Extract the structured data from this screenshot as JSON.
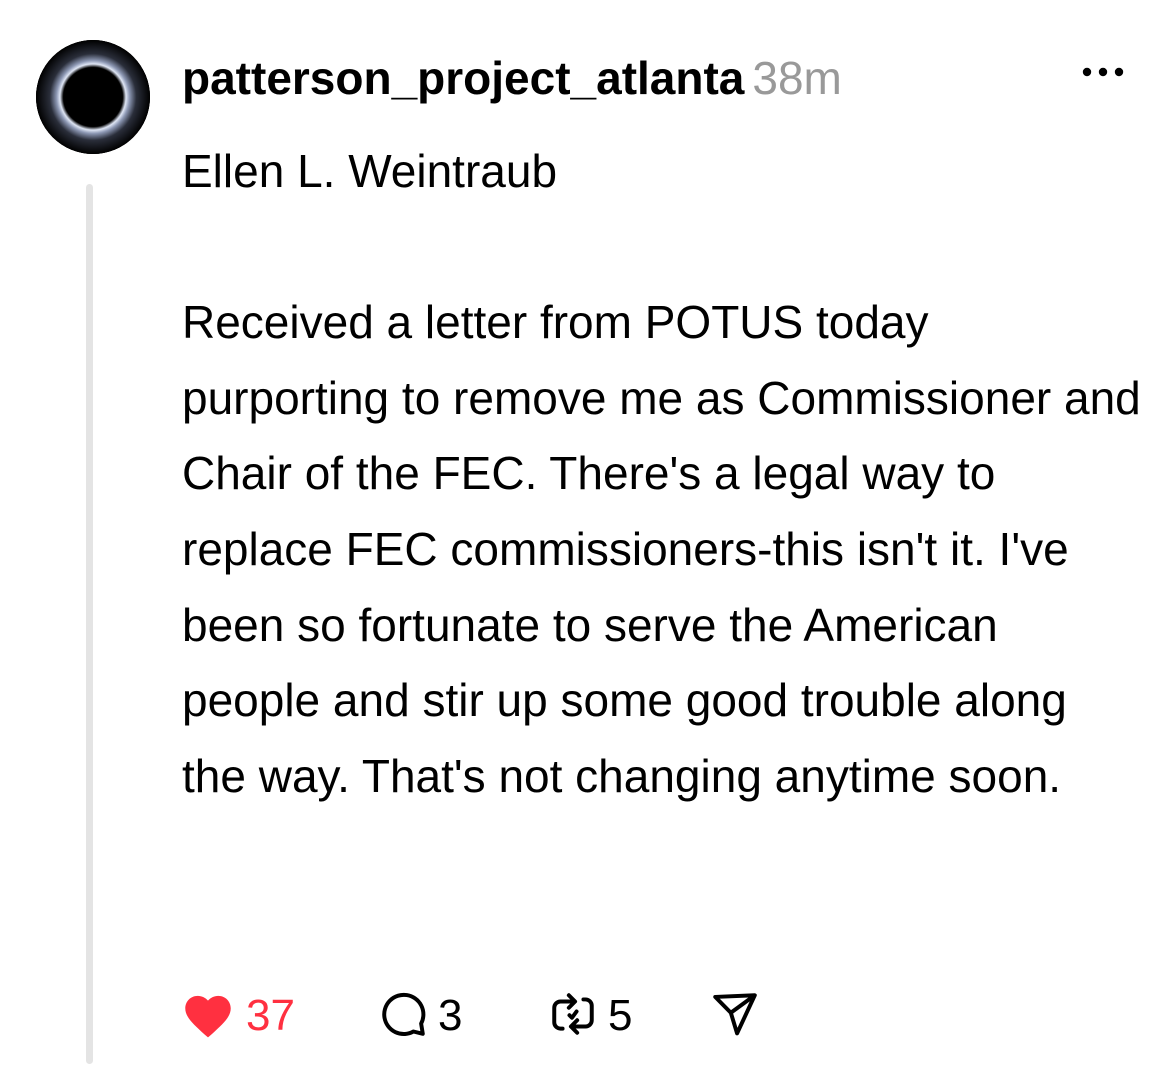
{
  "post": {
    "username": "patterson_project_atlanta",
    "timestamp": "38m",
    "body": "Ellen L. Weintraub\n\nReceived a letter from POTUS today purporting to remove me as Commissioner and Chair of the FEC. There's a legal way to replace FEC commissioners-this isn't it. I've been so fortunate to serve the American people and stir up some good trouble along the way. That's not changing anytime soon."
  },
  "actions": {
    "likes": "37",
    "comments": "3",
    "reposts": "5"
  },
  "icons": {
    "like": "heart-icon",
    "comment": "comment-bubble-icon",
    "repost": "repost-icon",
    "share": "send-icon",
    "more": "more-dots-icon"
  },
  "colors": {
    "like": "#ff3040",
    "timestamp": "#999999",
    "thread_line": "#e4e4e4"
  }
}
